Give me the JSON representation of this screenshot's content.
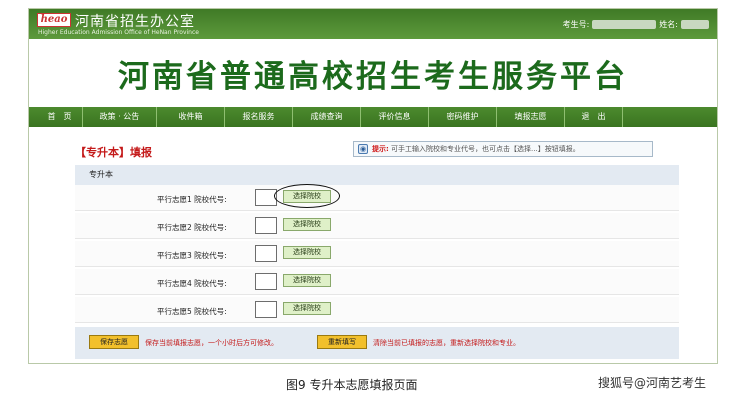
{
  "header": {
    "logo_text": "heao",
    "office_name": "河南省招生办公室",
    "office_name_en": "Higher Education Admission Office of HeNan Province",
    "candidate_no_label": "考生号:",
    "name_label": "姓名:"
  },
  "banner": {
    "title": "河南省普通高校招生考生服务平台"
  },
  "nav": {
    "items": [
      "首　页",
      "政策 · 公告",
      "收件箱",
      "报名服务",
      "成绩查询",
      "评价信息",
      "密码维护",
      "填报志愿",
      "退　出"
    ]
  },
  "page": {
    "heading": "【专升本】填报",
    "hint_label": "提示:",
    "hint_text": "可手工输入院校和专业代号，也可点击【选择...】按钮填报。",
    "hint_icon": "info-icon",
    "section_title": "专升本",
    "rows": [
      {
        "label": "平行志愿1  院校代号:",
        "button": "选择院校"
      },
      {
        "label": "平行志愿2  院校代号:",
        "button": "选择院校"
      },
      {
        "label": "平行志愿3  院校代号:",
        "button": "选择院校"
      },
      {
        "label": "平行志愿4  院校代号:",
        "button": "选择院校"
      },
      {
        "label": "平行志愿5  院校代号:",
        "button": "选择院校"
      }
    ],
    "save_button": "保存志愿",
    "save_note": "保存当前填报志愿，一个小时后方可修改。",
    "refill_button": "重新填写",
    "refill_note": "清除当前已填报的志愿，重新选择院校和专业。"
  },
  "figure_caption": "图9  专升本志愿填报页面",
  "watermark": "搜狐号@河南艺考生",
  "colors": {
    "nav_green": "#3a7420",
    "title_green": "#1c6a1c",
    "accent_red": "#c41a1a",
    "button_yellow": "#f2c02c",
    "pick_button_green": "#dff0c8"
  }
}
